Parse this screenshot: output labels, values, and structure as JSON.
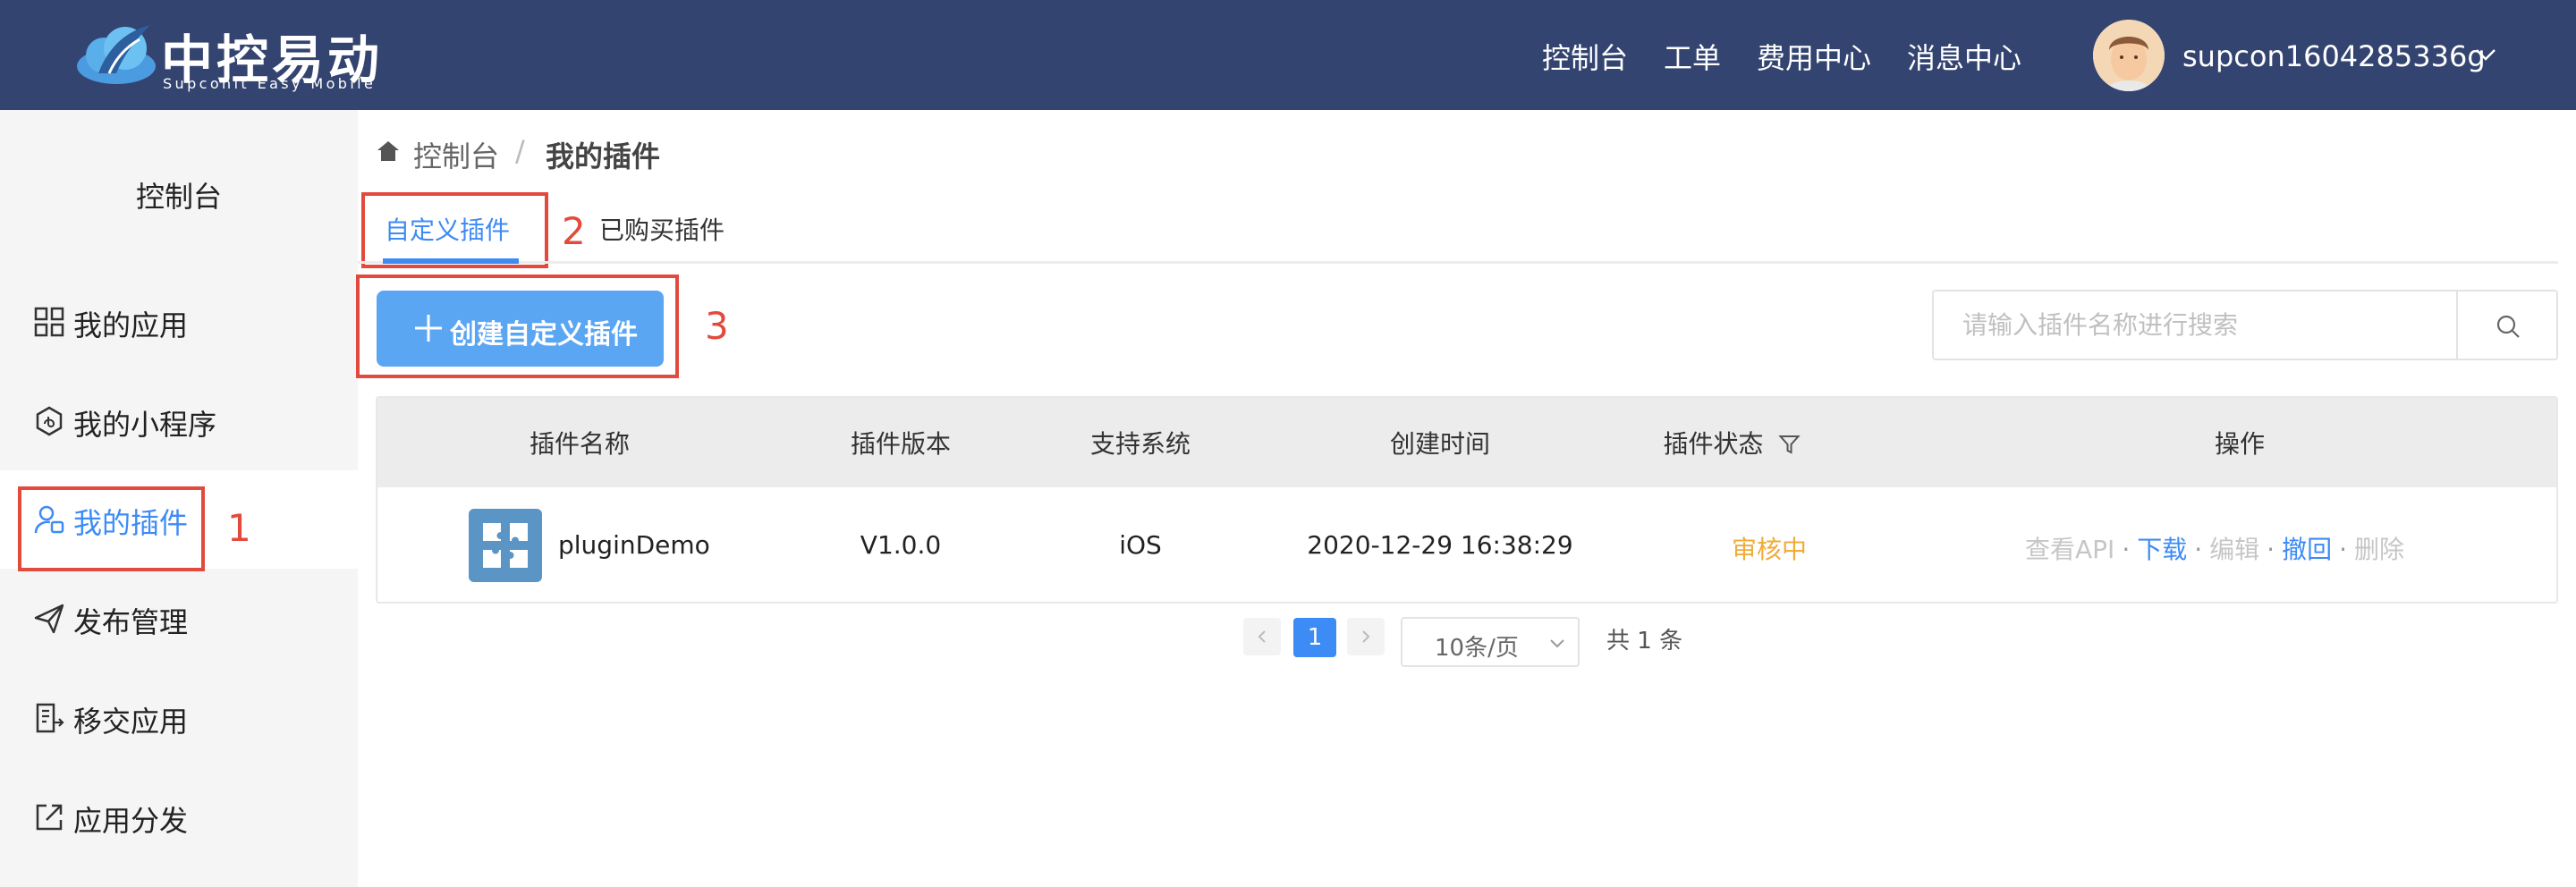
{
  "colors": {
    "header_bg": "#344470",
    "accent": "#3d8bf5",
    "status_reviewing": "#f0ab3a",
    "annotation": "#e24a3d"
  },
  "header": {
    "logo_title": "中控易动",
    "logo_subtitle": "Supconit Easy Mobile",
    "nav": [
      {
        "label": "控制台"
      },
      {
        "label": "工单"
      },
      {
        "label": "费用中心"
      },
      {
        "label": "消息中心"
      }
    ],
    "username": "supcon1604285336g"
  },
  "sidebar": {
    "title": "控制台",
    "items": [
      {
        "label": "我的应用",
        "icon": "grid-icon"
      },
      {
        "label": "我的小程序",
        "icon": "mini-program-icon"
      },
      {
        "label": "我的插件",
        "icon": "user-plugin-icon",
        "active": true
      },
      {
        "label": "发布管理",
        "icon": "send-icon"
      },
      {
        "label": "移交应用",
        "icon": "transfer-document-icon"
      },
      {
        "label": "应用分发",
        "icon": "share-external-icon"
      }
    ]
  },
  "breadcrumb": {
    "root": "控制台",
    "separator": "/",
    "current": "我的插件"
  },
  "tabs": [
    {
      "label": "自定义插件",
      "active": true
    },
    {
      "label": "已购买插件",
      "active": false
    }
  ],
  "toolbar": {
    "create_button": "创建自定义插件",
    "search_placeholder": "请输入插件名称进行搜索"
  },
  "annotations": [
    "1",
    "2",
    "3"
  ],
  "table": {
    "columns": [
      "插件名称",
      "插件版本",
      "支持系统",
      "创建时间",
      "插件状态",
      "操作"
    ],
    "rows": [
      {
        "name": "pluginDemo",
        "version": "V1.0.0",
        "system": "iOS",
        "created": "2020-12-29 16:38:29",
        "status": "审核中",
        "actions": [
          {
            "label": "查看API",
            "enabled": false
          },
          {
            "label": "下载",
            "enabled": true
          },
          {
            "label": "编辑",
            "enabled": false
          },
          {
            "label": "撤回",
            "enabled": true
          },
          {
            "label": "删除",
            "enabled": false
          }
        ]
      }
    ]
  },
  "pagination": {
    "current": "1",
    "page_size": "10条/页",
    "total": "共 1 条"
  }
}
